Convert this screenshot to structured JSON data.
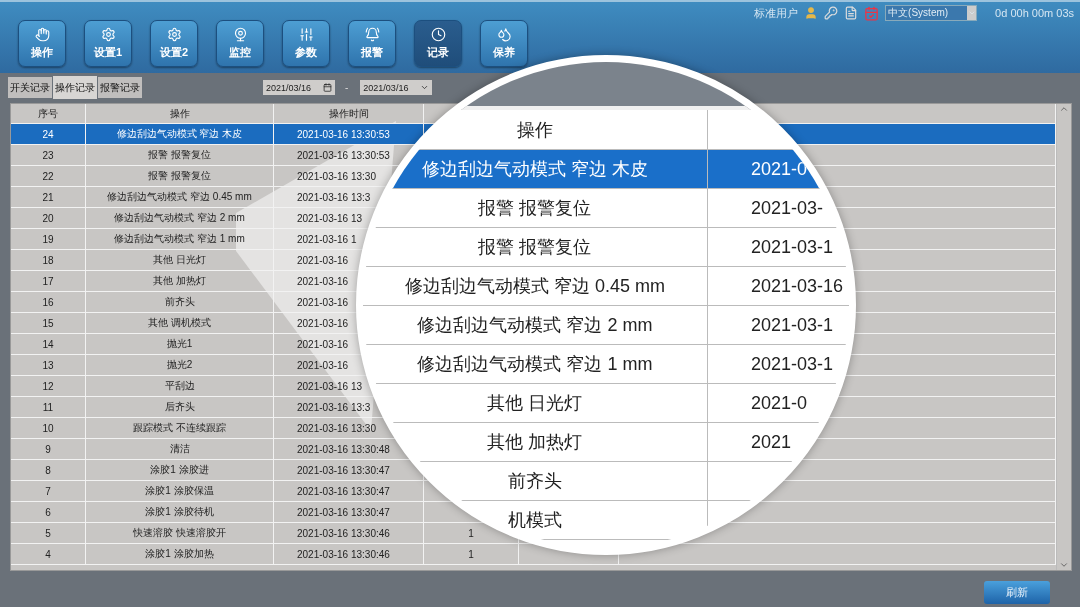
{
  "toolbar": {
    "buttons": [
      {
        "label": "操作",
        "selected": false
      },
      {
        "label": "设置1",
        "selected": false
      },
      {
        "label": "设置2",
        "selected": false
      },
      {
        "label": "监控",
        "selected": false
      },
      {
        "label": "参数",
        "selected": false
      },
      {
        "label": "报警",
        "selected": false
      },
      {
        "label": "记录",
        "selected": true
      },
      {
        "label": "保养",
        "selected": false
      }
    ]
  },
  "status": {
    "user": "标准用户",
    "language": "中文(System)",
    "uptime": "0d 00h 00m 03s"
  },
  "tabs": [
    {
      "label": "开关记录",
      "selected": false
    },
    {
      "label": "操作记录",
      "selected": true
    },
    {
      "label": "报警记录",
      "selected": false
    }
  ],
  "date_range": {
    "from": "2021/03/16",
    "separator": "-",
    "to": "2021/03/16"
  },
  "table": {
    "columns": [
      "序号",
      "操作",
      "操作时间"
    ],
    "rows": [
      {
        "no": "24",
        "operation": "修边刮边气动模式 窄边 木皮",
        "time": "2021-03-16 13:30:53",
        "selected": true
      },
      {
        "no": "23",
        "operation": "报警 报警复位",
        "time": "2021-03-16 13:30:53",
        "selected": false
      },
      {
        "no": "22",
        "operation": "报警 报警复位",
        "time": "2021-03-16 13:30",
        "selected": false
      },
      {
        "no": "21",
        "operation": "修边刮边气动模式 窄边 0.45 mm",
        "time": "2021-03-16 13:3",
        "selected": false
      },
      {
        "no": "20",
        "operation": "修边刮边气动模式 窄边 2 mm",
        "time": "2021-03-16 13",
        "selected": false
      },
      {
        "no": "19",
        "operation": "修边刮边气动模式 窄边 1 mm",
        "time": "2021-03-16 1",
        "selected": false
      },
      {
        "no": "18",
        "operation": "其他 日光灯",
        "time": "2021-03-16",
        "selected": false
      },
      {
        "no": "17",
        "operation": "其他 加热灯",
        "time": "2021-03-16",
        "selected": false
      },
      {
        "no": "16",
        "operation": "前齐头",
        "time": "2021-03-16",
        "selected": false
      },
      {
        "no": "15",
        "operation": "其他 调机模式",
        "time": "2021-03-16",
        "selected": false
      },
      {
        "no": "14",
        "operation": "抛光1",
        "time": "2021-03-16",
        "selected": false
      },
      {
        "no": "13",
        "operation": "抛光2",
        "time": "2021-03-16",
        "selected": false
      },
      {
        "no": "12",
        "operation": "平刮边",
        "time": "2021-03-16 13",
        "selected": false
      },
      {
        "no": "11",
        "operation": "后齐头",
        "time": "2021-03-16 13:3",
        "selected": false
      },
      {
        "no": "10",
        "operation": "跟踪模式 不连续跟踪",
        "time": "2021-03-16 13:30",
        "selected": false
      },
      {
        "no": "9",
        "operation": "清洁",
        "time": "2021-03-16 13:30:48",
        "selected": false
      },
      {
        "no": "8",
        "operation": "涂胶1 涂胶进",
        "time": "2021-03-16 13:30:47",
        "selected": false
      },
      {
        "no": "7",
        "operation": "涂胶1 涂胶保温",
        "time": "2021-03-16 13:30:47",
        "selected": false
      },
      {
        "no": "6",
        "operation": "涂胶1 涂胶待机",
        "time": "2021-03-16 13:30:47",
        "selected": false
      },
      {
        "no": "5",
        "operation": "快速溶胶 快速溶胶开",
        "time": "2021-03-16 13:30:46",
        "column_4": "1",
        "selected": false
      },
      {
        "no": "4",
        "operation": "涂胶1 涂胶加热",
        "time": "2021-03-16 13:30:46",
        "column_4": "1",
        "selected": false
      }
    ]
  },
  "magnifier": {
    "header": "操作",
    "rows": [
      {
        "operation": "修边刮边气动模式 窄边 木皮",
        "time": "2021-0",
        "selected": true
      },
      {
        "operation": "报警 报警复位",
        "time": "2021-03-",
        "selected": false
      },
      {
        "operation": "报警 报警复位",
        "time": "2021-03-1",
        "selected": false
      },
      {
        "operation": "修边刮边气动模式 窄边 0.45 mm",
        "time": "2021-03-16",
        "selected": false
      },
      {
        "operation": "修边刮边气动模式 窄边 2 mm",
        "time": "2021-03-1",
        "selected": false
      },
      {
        "operation": "修边刮边气动模式 窄边 1 mm",
        "time": "2021-03-1",
        "selected": false
      },
      {
        "operation": "其他 日光灯",
        "time": "2021-0",
        "selected": false
      },
      {
        "operation": "其他 加热灯",
        "time": "2021",
        "selected": false
      },
      {
        "operation": "前齐头",
        "selected": false
      },
      {
        "operation": "机模式",
        "selected": false
      }
    ]
  },
  "refresh_button": "刷新"
}
